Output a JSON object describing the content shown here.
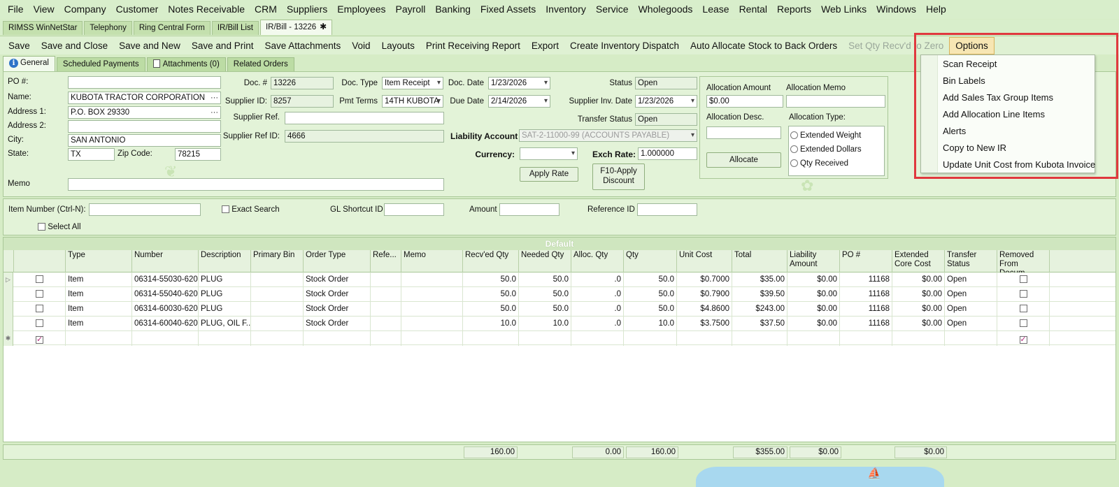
{
  "menu": [
    "File",
    "View",
    "Company",
    "Customer",
    "Notes Receivable",
    "CRM",
    "Suppliers",
    "Employees",
    "Payroll",
    "Banking",
    "Fixed Assets",
    "Inventory",
    "Service",
    "Wholegoods",
    "Lease",
    "Rental",
    "Reports",
    "Web Links",
    "Windows",
    "Help"
  ],
  "doc_tabs": [
    "RIMSS WinNetStar",
    "Telephony",
    "Ring Central Form",
    "IR/Bill List",
    "IR/Bill - 13226"
  ],
  "toolbar": [
    "Save",
    "Save and Close",
    "Save and New",
    "Save and Print",
    "Save Attachments",
    "Void",
    "Layouts",
    "Print Receiving Report",
    "Export",
    "Create Inventory Dispatch",
    "Auto Allocate Stock to Back Orders",
    "Set Qty Recv'd to Zero",
    "Options"
  ],
  "section_tabs": [
    "General",
    "Scheduled Payments",
    "Attachments (0)",
    "Related Orders"
  ],
  "form": {
    "po_label": "PO #:",
    "po": "",
    "name_label": "Name:",
    "name": "KUBOTA TRACTOR CORPORATION",
    "addr1_label": "Address 1:",
    "addr1": "P.O. BOX 29330",
    "addr2_label": "Address 2:",
    "addr2": "",
    "city_label": "City:",
    "city": "SAN ANTONIO",
    "state_label": "State:",
    "state": "TX",
    "zip_label": "Zip Code:",
    "zip": "78215",
    "memo_label": "Memo",
    "memo": "",
    "doc_no_label": "Doc. #",
    "doc_no": "13226",
    "supplier_id_label": "Supplier ID:",
    "supplier_id": "8257",
    "supplier_ref_label": "Supplier Ref.",
    "supplier_ref": "",
    "supplier_ref_id_label": "Supplier Ref ID:",
    "supplier_ref_id": "4666",
    "doc_type_label": "Doc. Type",
    "doc_type": "Item Receipt",
    "pmt_terms_label": "Pmt Terms",
    "pmt_terms": "14TH KUBOTA",
    "doc_date_label": "Doc. Date",
    "doc_date": "1/23/2026",
    "due_date_label": "Due Date",
    "due_date": "2/14/2026",
    "status_label": "Status",
    "status": "Open",
    "supplier_inv_date_label": "Supplier Inv. Date",
    "supplier_inv_date": "1/23/2026",
    "transfer_status_label": "Transfer Status",
    "transfer_status": "Open",
    "liability_label": "Liability Account",
    "liability": "SAT-2-11000-99 (ACCOUNTS PAYABLE)",
    "currency_label": "Currency:",
    "currency": "",
    "exch_rate_label": "Exch Rate:",
    "exch_rate": "1.000000",
    "apply_rate": "Apply Rate",
    "f10_line1": "F10-Apply",
    "f10_line2": "Discount"
  },
  "allocation": {
    "amount_label": "Allocation Amount",
    "amount": "$0.00",
    "memo_label": "Allocation Memo",
    "memo": "",
    "desc_label": "Allocation Desc.",
    "desc": "",
    "type_label": "Allocation Type:",
    "types": [
      "Extended Weight",
      "Extended Dollars",
      "Qty Received"
    ],
    "allocate": "Allocate"
  },
  "search": {
    "item_label": "Item Number (Ctrl-N):",
    "exact": "Exact Search",
    "gl_label": "GL Shortcut ID",
    "amount_label": "Amount",
    "ref_label": "Reference ID",
    "select_all": "Select All"
  },
  "grid": {
    "title": "Default",
    "headers": [
      "Type",
      "Number",
      "Description",
      "Primary Bin",
      "Order Type",
      "Refe...",
      "Memo",
      "Recv'ed Qty",
      "Needed Qty",
      "Alloc. Qty",
      "Qty",
      "Unit Cost",
      "Total",
      "Liability Amount",
      "PO #",
      "Extended Core Cost",
      "Transfer Status",
      "Removed From Docum..."
    ],
    "rows": [
      {
        "type": "Item",
        "number": "06314-55030-620",
        "desc": "PLUG",
        "bin": "",
        "order_type": "Stock Order",
        "ref": "",
        "memo": "",
        "recv": "50.0",
        "needed": "50.0",
        "alloc": ".0",
        "qty": "50.0",
        "unit": "$0.7000",
        "total": "$35.00",
        "liab": "$0.00",
        "po": "11168",
        "core": "$0.00",
        "transfer": "Open"
      },
      {
        "type": "Item",
        "number": "06314-55040-620",
        "desc": "PLUG",
        "bin": "",
        "order_type": "Stock Order",
        "ref": "",
        "memo": "",
        "recv": "50.0",
        "needed": "50.0",
        "alloc": ".0",
        "qty": "50.0",
        "unit": "$0.7900",
        "total": "$39.50",
        "liab": "$0.00",
        "po": "11168",
        "core": "$0.00",
        "transfer": "Open"
      },
      {
        "type": "Item",
        "number": "06314-60030-620",
        "desc": "PLUG",
        "bin": "",
        "order_type": "Stock Order",
        "ref": "",
        "memo": "",
        "recv": "50.0",
        "needed": "50.0",
        "alloc": ".0",
        "qty": "50.0",
        "unit": "$4.8600",
        "total": "$243.00",
        "liab": "$0.00",
        "po": "11168",
        "core": "$0.00",
        "transfer": "Open"
      },
      {
        "type": "Item",
        "number": "06314-60040-620",
        "desc": "PLUG, OIL F...",
        "bin": "",
        "order_type": "Stock Order",
        "ref": "",
        "memo": "",
        "recv": "10.0",
        "needed": "10.0",
        "alloc": ".0",
        "qty": "10.0",
        "unit": "$3.7500",
        "total": "$37.50",
        "liab": "$0.00",
        "po": "11168",
        "core": "$0.00",
        "transfer": "Open"
      }
    ]
  },
  "totals": {
    "recv": "160.00",
    "alloc": "0.00",
    "qty": "160.00",
    "total": "$355.00",
    "liab": "$0.00",
    "core": "$0.00"
  },
  "options_menu": [
    "Scan Receipt",
    "Bin Labels",
    "Add Sales Tax Group Items",
    "Add Allocation Line Items",
    "Alerts",
    "Copy to New IR",
    "Update Unit Cost from Kubota Invoice"
  ],
  "colors": {
    "highlight_box": "#e0383e",
    "app_bg": "#d6ecc6"
  }
}
